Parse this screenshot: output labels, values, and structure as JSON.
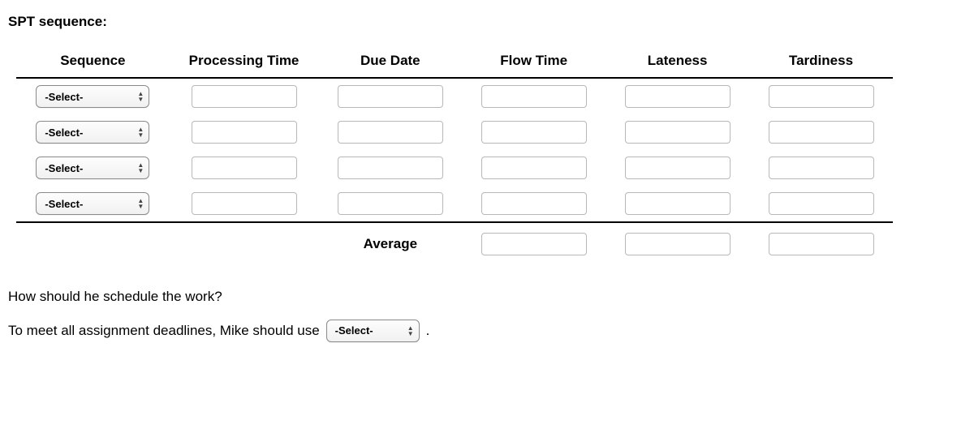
{
  "title": "SPT sequence:",
  "headers": {
    "sequence": "Sequence",
    "processing": "Processing Time",
    "due": "Due Date",
    "flow": "Flow Time",
    "lateness": "Lateness",
    "tardiness": "Tardiness"
  },
  "rows": [
    {
      "sequence": "-Select-",
      "processing": "",
      "due": "",
      "flow": "",
      "lateness": "",
      "tardiness": ""
    },
    {
      "sequence": "-Select-",
      "processing": "",
      "due": "",
      "flow": "",
      "lateness": "",
      "tardiness": ""
    },
    {
      "sequence": "-Select-",
      "processing": "",
      "due": "",
      "flow": "",
      "lateness": "",
      "tardiness": ""
    },
    {
      "sequence": "-Select-",
      "processing": "",
      "due": "",
      "flow": "",
      "lateness": "",
      "tardiness": ""
    }
  ],
  "average": {
    "label": "Average",
    "flow": "",
    "lateness": "",
    "tardiness": ""
  },
  "question": {
    "line1": "How should he schedule the work?",
    "line2a": "To meet all assignment deadlines, Mike should use",
    "select": "-Select-",
    "line2b": "."
  }
}
